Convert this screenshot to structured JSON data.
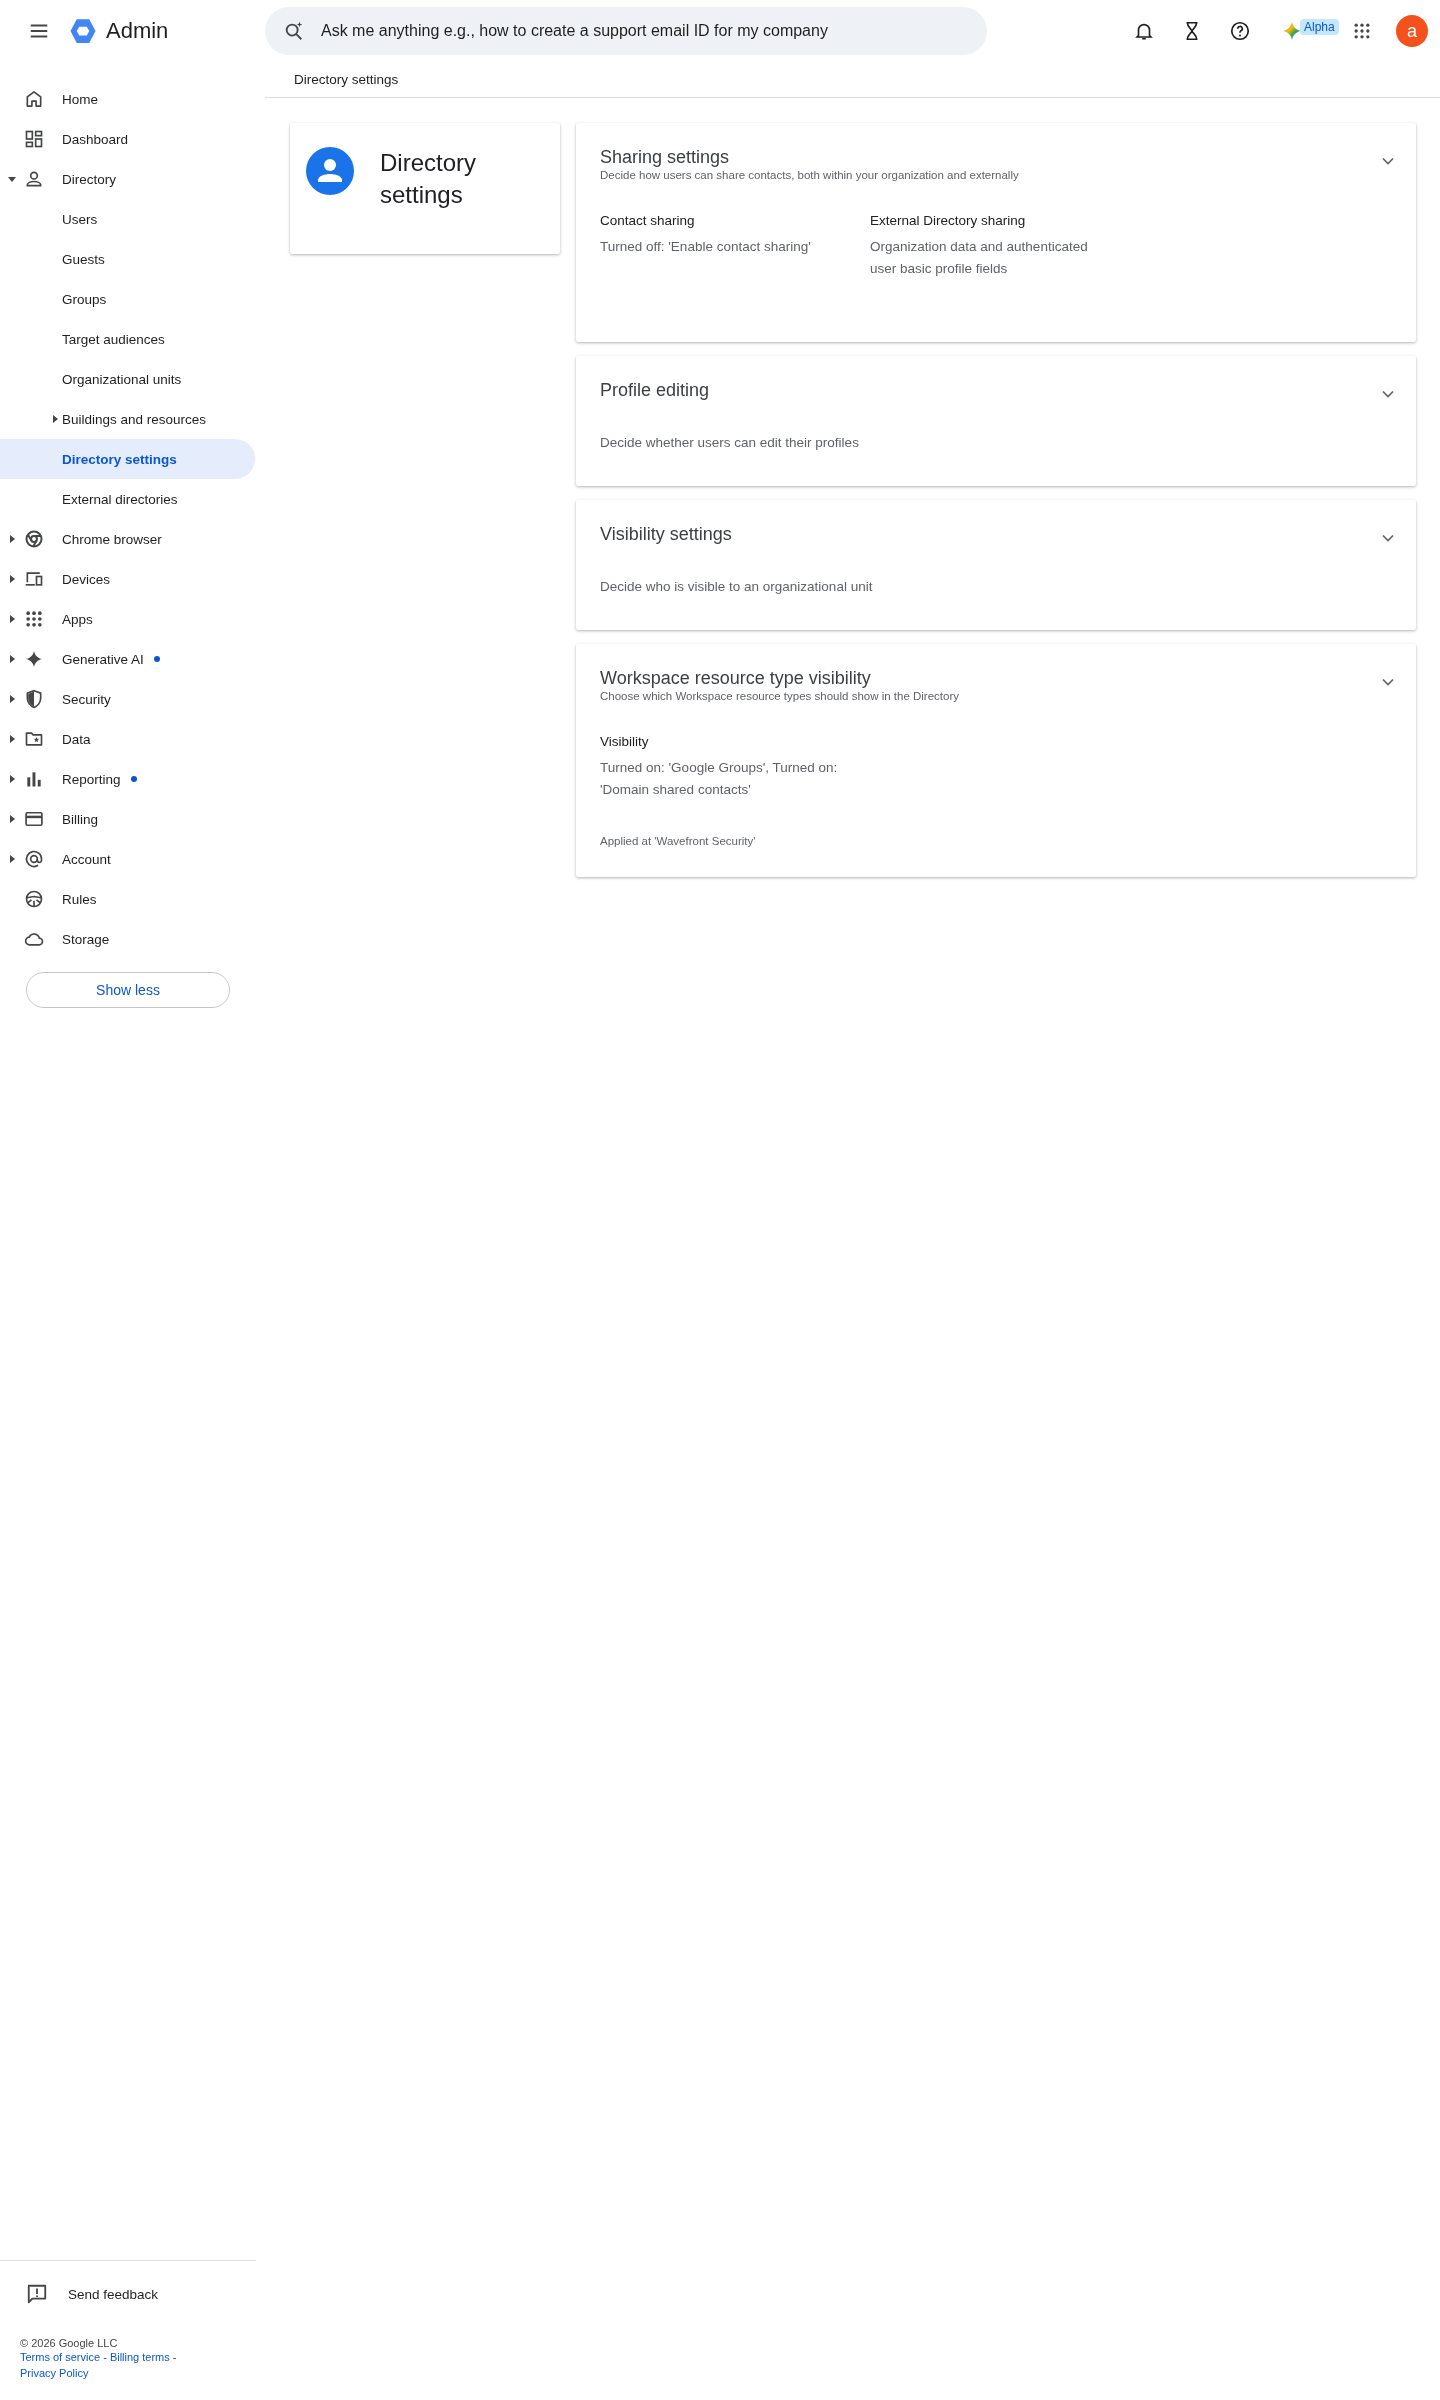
{
  "header": {
    "product": "Admin",
    "search": {
      "placeholder": "Ask me anything e.g., how to create a support email ID for my company"
    },
    "alpha_badge": "Alpha",
    "avatar_letter": "a"
  },
  "breadcrumb": "Directory settings",
  "nav": {
    "items": [
      {
        "label": "Home",
        "selected": false,
        "new_dot": false
      },
      {
        "label": "Dashboard",
        "selected": false,
        "new_dot": false
      },
      {
        "label": "Directory",
        "selected": false,
        "new_dot": false,
        "expanded": true,
        "children": [
          {
            "label": "Users",
            "selected": false
          },
          {
            "label": "Guests",
            "selected": false
          },
          {
            "label": "Groups",
            "selected": false
          },
          {
            "label": "Target audiences",
            "selected": false
          },
          {
            "label": "Organizational units",
            "selected": false
          },
          {
            "label": "Buildings and resources",
            "selected": false,
            "expanded": false
          },
          {
            "label": "Directory settings",
            "selected": true
          },
          {
            "label": "External directories",
            "selected": false
          }
        ]
      },
      {
        "label": "Chrome browser",
        "selected": false,
        "new_dot": false,
        "expanded": false
      },
      {
        "label": "Devices",
        "selected": false,
        "new_dot": false,
        "expanded": false
      },
      {
        "label": "Apps",
        "selected": false,
        "new_dot": false,
        "expanded": false
      },
      {
        "label": "Generative AI",
        "selected": false,
        "new_dot": true,
        "expanded": false
      },
      {
        "label": "Security",
        "selected": false,
        "new_dot": false,
        "expanded": false
      },
      {
        "label": "Data",
        "selected": false,
        "new_dot": false,
        "expanded": false
      },
      {
        "label": "Reporting",
        "selected": false,
        "new_dot": true,
        "expanded": false
      },
      {
        "label": "Billing",
        "selected": false,
        "new_dot": false,
        "expanded": false
      },
      {
        "label": "Account",
        "selected": false,
        "new_dot": false,
        "expanded": false
      },
      {
        "label": "Rules",
        "selected": false,
        "new_dot": false
      },
      {
        "label": "Storage",
        "selected": false,
        "new_dot": false
      }
    ],
    "show_less": "Show less"
  },
  "footer": {
    "send_feedback": "Send feedback",
    "copyright": "© 2026 Google LLC",
    "links": [
      "Terms of service",
      "Billing terms",
      "Privacy Policy"
    ],
    "separator": "-"
  },
  "summary_card": {
    "title": "Directory settings"
  },
  "sections": [
    {
      "title": "Sharing settings",
      "subtitle": "Decide how users can share contacts, both within your organization and externally",
      "expanded": false,
      "fields": [
        {
          "label": "Contact sharing",
          "value": "Turned off: 'Enable contact sharing'"
        },
        {
          "label": "External Directory sharing",
          "value": "Organization data and authenticated user basic profile fields"
        }
      ]
    },
    {
      "title": "Profile editing",
      "description": "Decide whether users can edit their profiles",
      "expanded": false
    },
    {
      "title": "Visibility settings",
      "description": "Decide who is visible to an organizational unit",
      "expanded": false
    },
    {
      "title": "Workspace resource type visibility",
      "subtitle": "Choose which Workspace resource types should show in the Directory",
      "expanded": false,
      "fields": [
        {
          "label": "Visibility",
          "value": "Turned on: 'Google Groups', Turned on: 'Domain shared contacts'"
        }
      ],
      "note": "Applied at 'Wavefront Security'"
    }
  ]
}
